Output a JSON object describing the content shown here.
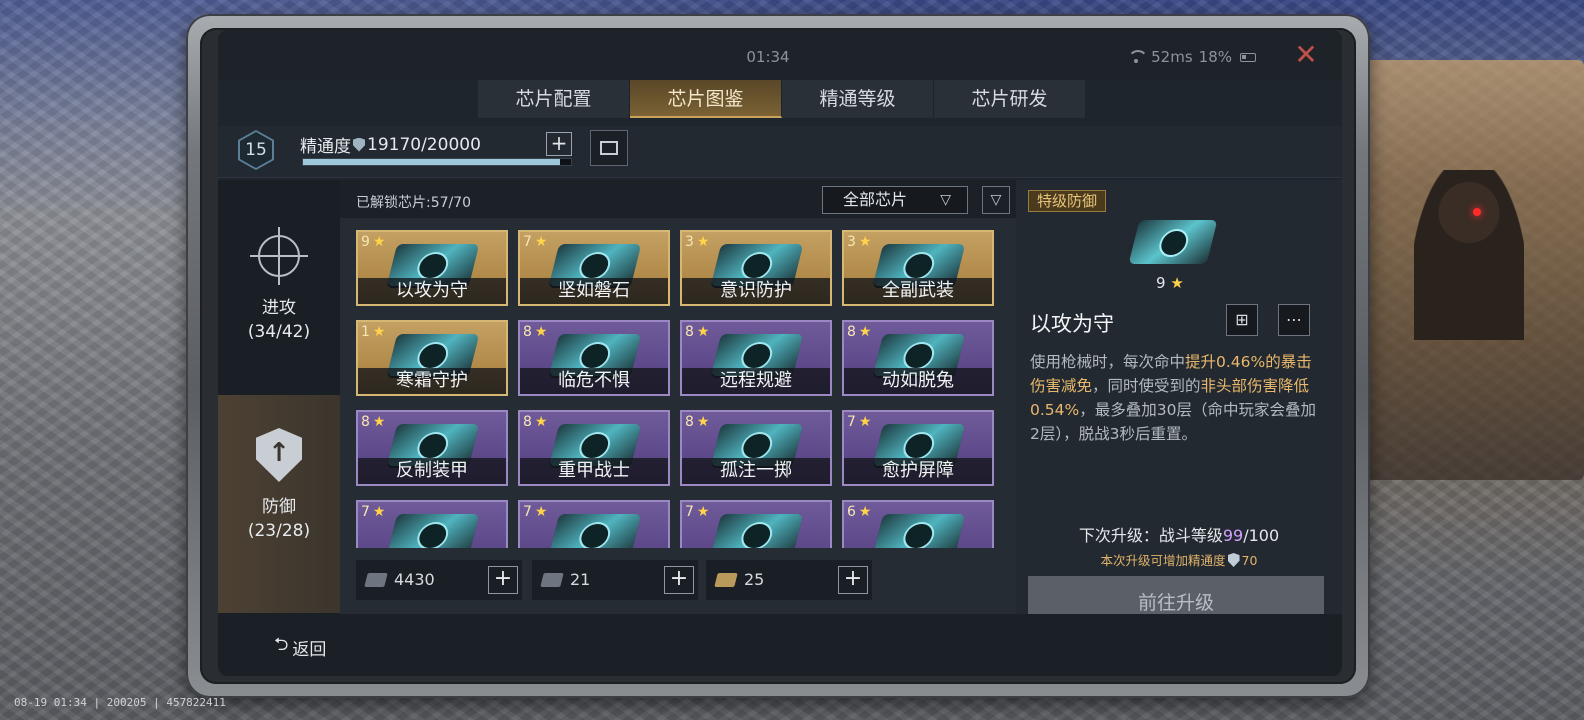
{
  "status": {
    "time": "01:34",
    "ping": "52ms",
    "battery": "18%",
    "close_icon": "close-icon"
  },
  "tabs": [
    {
      "label": "芯片配置",
      "active": false
    },
    {
      "label": "芯片图鉴",
      "active": true
    },
    {
      "label": "精通等级",
      "active": false
    },
    {
      "label": "芯片研发",
      "active": false
    }
  ],
  "mastery": {
    "level": "15",
    "label": "精通度",
    "value": "19170/20000",
    "progress": 0.9585
  },
  "categories": [
    {
      "label": "进攻",
      "count": "(34/42)",
      "icon": "crosshair-icon"
    },
    {
      "label": "防御",
      "count": "(23/28)",
      "icon": "shield-icon"
    }
  ],
  "grid": {
    "unlocked": "已解锁芯片:57/70",
    "filter": "全部芯片",
    "cards": [
      {
        "stars": "9",
        "name": "以攻为守",
        "tier": "gold"
      },
      {
        "stars": "7",
        "name": "坚如磐石",
        "tier": "gold"
      },
      {
        "stars": "3",
        "name": "意识防护",
        "tier": "gold"
      },
      {
        "stars": "3",
        "name": "全副武装",
        "tier": "gold"
      },
      {
        "stars": "1",
        "name": "寒霜守护",
        "tier": "gold"
      },
      {
        "stars": "8",
        "name": "临危不惧",
        "tier": "purple"
      },
      {
        "stars": "8",
        "name": "远程规避",
        "tier": "purple"
      },
      {
        "stars": "8",
        "name": "动如脱兔",
        "tier": "purple"
      },
      {
        "stars": "8",
        "name": "反制装甲",
        "tier": "purple"
      },
      {
        "stars": "8",
        "name": "重甲战士",
        "tier": "purple"
      },
      {
        "stars": "8",
        "name": "孤注一掷",
        "tier": "purple"
      },
      {
        "stars": "7",
        "name": "愈护屏障",
        "tier": "purple"
      },
      {
        "stars": "7",
        "name": "",
        "tier": "purple"
      },
      {
        "stars": "7",
        "name": "",
        "tier": "purple"
      },
      {
        "stars": "7",
        "name": "",
        "tier": "purple"
      },
      {
        "stars": "6",
        "name": "",
        "tier": "purple"
      }
    ]
  },
  "resources": [
    {
      "value": "4430",
      "kind": "grey"
    },
    {
      "value": "21",
      "kind": "grey"
    },
    {
      "value": "25",
      "kind": "gold"
    }
  ],
  "detail": {
    "tier": "特级防御",
    "stars": "9",
    "name": "以攻为守",
    "desc_1": "使用枪械时，每次命中",
    "desc_hl_1": "提升0.46%的暴击伤害减免",
    "desc_2": "，同时使受到的",
    "desc_hl_2": "非头部伤害降低0.54%",
    "desc_3": "，最多叠加30层（命中玩家会叠加2层），脱战3秒后重置。",
    "next_prefix": "下次升级：战斗等级",
    "next_level": "99",
    "next_suffix": "/100",
    "next_sub_prefix": "本次升级可增加精通度",
    "next_sub_value": "70",
    "upgrade": "前往升级"
  },
  "footer": {
    "back": "返回"
  },
  "overlay": "08-19 01:34 | 200205 | 457822411",
  "colors": {
    "gold_card": "#b28b4a",
    "purple_card": "#5e4a8a",
    "highlight": "#e8b86c",
    "close": "#c0504a"
  }
}
